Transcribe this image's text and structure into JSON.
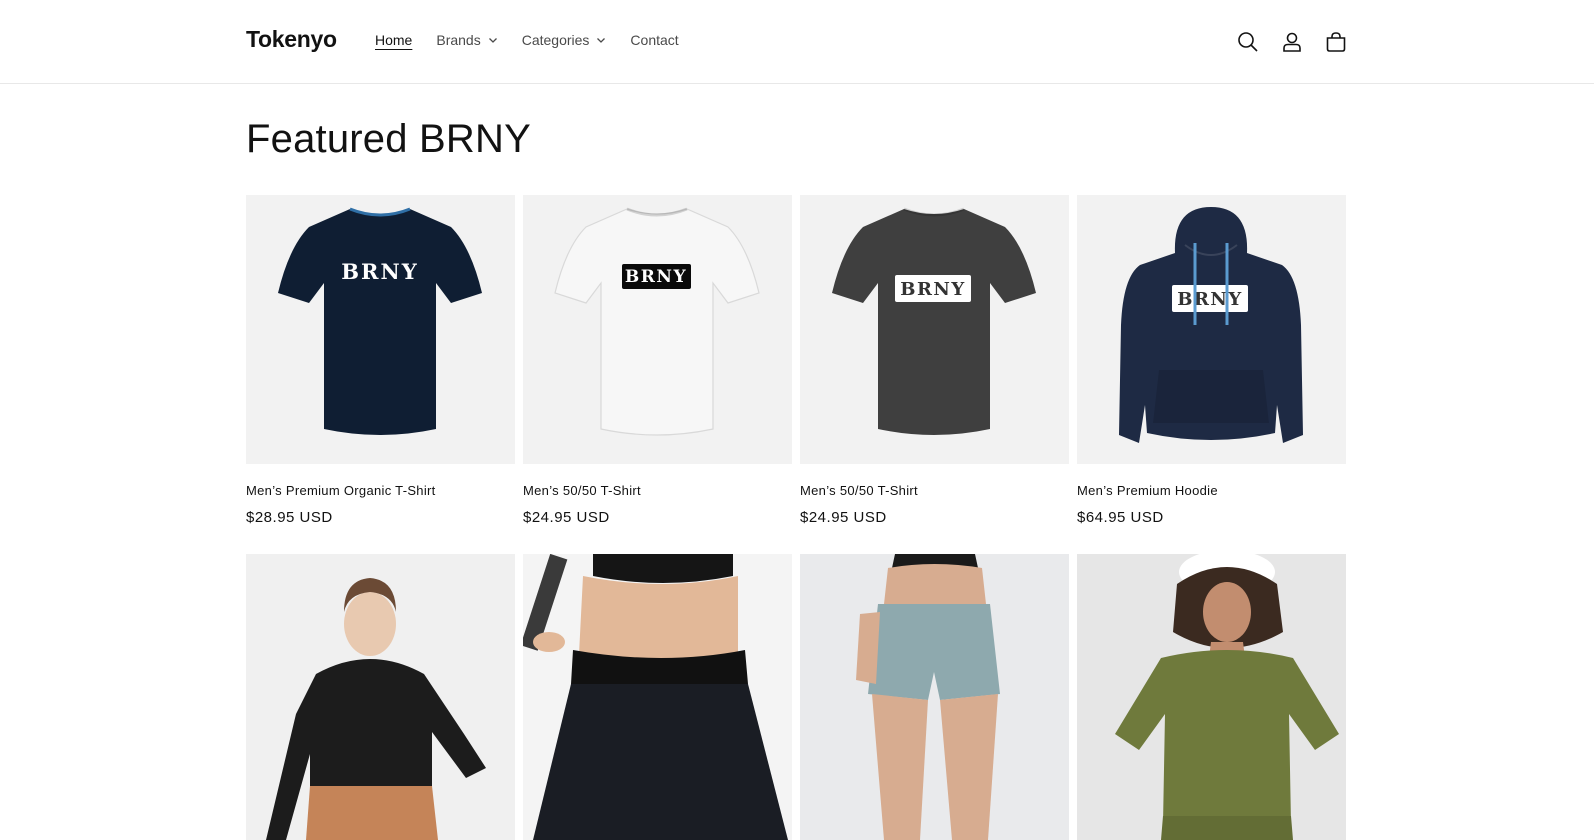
{
  "header": {
    "logo": "Tokenyo",
    "nav": [
      {
        "label": "Home",
        "active": true,
        "dropdown": false
      },
      {
        "label": "Brands",
        "active": false,
        "dropdown": true
      },
      {
        "label": "Categories",
        "active": false,
        "dropdown": true
      },
      {
        "label": "Contact",
        "active": false,
        "dropdown": false
      }
    ],
    "icons": [
      "search-icon",
      "account-icon",
      "cart-icon"
    ]
  },
  "main": {
    "title": "Featured BRNY",
    "products": [
      {
        "name": "Men’s Premium Organic T-Shirt",
        "price": "$28.95 USD",
        "garment": "tshirt",
        "color": "#0f1e33",
        "print_text": "BRNY",
        "print_style": "plain"
      },
      {
        "name": "Men’s 50/50 T-Shirt",
        "price": "$24.95 USD",
        "garment": "tshirt",
        "color": "#f7f7f7",
        "print_text": "BRNY",
        "print_style": "black-box"
      },
      {
        "name": "Men’s 50/50 T-Shirt",
        "price": "$24.95 USD",
        "garment": "tshirt",
        "color": "#3f3f3f",
        "print_text": "BRNY",
        "print_style": "white-box"
      },
      {
        "name": "Men’s Premium Hoodie",
        "price": "$64.95 USD",
        "garment": "hoodie",
        "color": "#1e2a44",
        "print_text": "BRNY",
        "print_style": "white-box"
      }
    ],
    "products_row2": [
      {
        "image": "black-cropped-hoodie-photo",
        "bg": "#f0f0f0"
      },
      {
        "image": "black-skirt-photo",
        "bg": "#f4f4f4"
      },
      {
        "image": "sage-shorts-photo",
        "bg": "#e9eaec"
      },
      {
        "image": "olive-tee-photo",
        "bg": "#e6e6e6"
      }
    ]
  }
}
